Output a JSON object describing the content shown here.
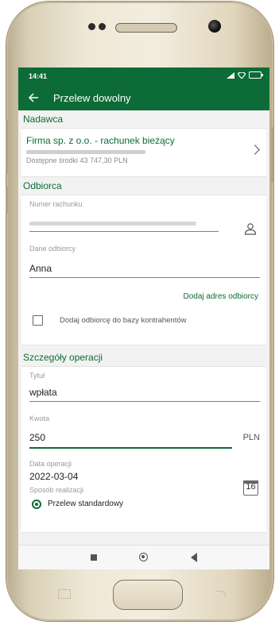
{
  "status": {
    "time": "14:41",
    "battery": "80"
  },
  "appbar": {
    "title": "Przelew dowolny"
  },
  "sender": {
    "section_title": "Nadawca",
    "account_name": "Firma sp. z o.o. - rachunek bieżący",
    "available_funds": "Dostępne środki 43 747,30 PLN"
  },
  "recipient": {
    "section_title": "Odbiorca",
    "account_number_label": "Numer rachunku",
    "recipient_data_label": "Dane odbiorcy",
    "recipient_data_value": "Anna",
    "add_address_link": "Dodaj adres odbiorcy",
    "add_to_contacts_label": "Dodaj odbiorcę do bazy kontrahentów"
  },
  "details": {
    "section_title": "Szczegóły operacji",
    "title_label": "Tytuł",
    "title_value": "wpłata",
    "amount_label": "Kwota",
    "amount_value": "250",
    "currency": "PLN",
    "date_label": "Data operacji",
    "date_value": "2022-03-04",
    "calendar_day": "16",
    "method_label": "Sposób realizacji",
    "method_value": "Przelew standardowy"
  }
}
